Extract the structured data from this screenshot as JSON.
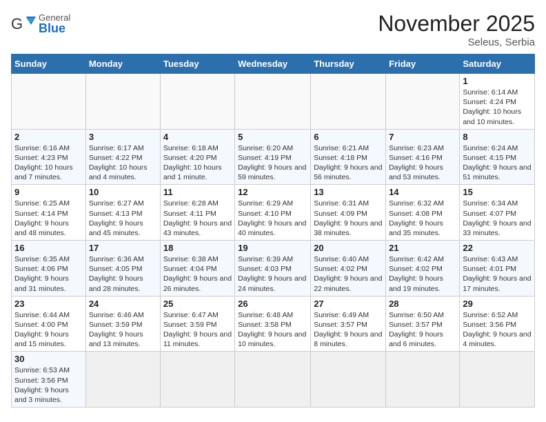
{
  "header": {
    "logo_general": "General",
    "logo_blue": "Blue",
    "month": "November 2025",
    "location": "Seleus, Serbia"
  },
  "days_of_week": [
    "Sunday",
    "Monday",
    "Tuesday",
    "Wednesday",
    "Thursday",
    "Friday",
    "Saturday"
  ],
  "weeks": [
    [
      {
        "day": "",
        "info": ""
      },
      {
        "day": "",
        "info": ""
      },
      {
        "day": "",
        "info": ""
      },
      {
        "day": "",
        "info": ""
      },
      {
        "day": "",
        "info": ""
      },
      {
        "day": "",
        "info": ""
      },
      {
        "day": "1",
        "info": "Sunrise: 6:14 AM\nSunset: 4:24 PM\nDaylight: 10 hours and 10 minutes."
      }
    ],
    [
      {
        "day": "2",
        "info": "Sunrise: 6:16 AM\nSunset: 4:23 PM\nDaylight: 10 hours and 7 minutes."
      },
      {
        "day": "3",
        "info": "Sunrise: 6:17 AM\nSunset: 4:22 PM\nDaylight: 10 hours and 4 minutes."
      },
      {
        "day": "4",
        "info": "Sunrise: 6:18 AM\nSunset: 4:20 PM\nDaylight: 10 hours and 1 minute."
      },
      {
        "day": "5",
        "info": "Sunrise: 6:20 AM\nSunset: 4:19 PM\nDaylight: 9 hours and 59 minutes."
      },
      {
        "day": "6",
        "info": "Sunrise: 6:21 AM\nSunset: 4:18 PM\nDaylight: 9 hours and 56 minutes."
      },
      {
        "day": "7",
        "info": "Sunrise: 6:23 AM\nSunset: 4:16 PM\nDaylight: 9 hours and 53 minutes."
      },
      {
        "day": "8",
        "info": "Sunrise: 6:24 AM\nSunset: 4:15 PM\nDaylight: 9 hours and 51 minutes."
      }
    ],
    [
      {
        "day": "9",
        "info": "Sunrise: 6:25 AM\nSunset: 4:14 PM\nDaylight: 9 hours and 48 minutes."
      },
      {
        "day": "10",
        "info": "Sunrise: 6:27 AM\nSunset: 4:13 PM\nDaylight: 9 hours and 45 minutes."
      },
      {
        "day": "11",
        "info": "Sunrise: 6:28 AM\nSunset: 4:11 PM\nDaylight: 9 hours and 43 minutes."
      },
      {
        "day": "12",
        "info": "Sunrise: 6:29 AM\nSunset: 4:10 PM\nDaylight: 9 hours and 40 minutes."
      },
      {
        "day": "13",
        "info": "Sunrise: 6:31 AM\nSunset: 4:09 PM\nDaylight: 9 hours and 38 minutes."
      },
      {
        "day": "14",
        "info": "Sunrise: 6:32 AM\nSunset: 4:08 PM\nDaylight: 9 hours and 35 minutes."
      },
      {
        "day": "15",
        "info": "Sunrise: 6:34 AM\nSunset: 4:07 PM\nDaylight: 9 hours and 33 minutes."
      }
    ],
    [
      {
        "day": "16",
        "info": "Sunrise: 6:35 AM\nSunset: 4:06 PM\nDaylight: 9 hours and 31 minutes."
      },
      {
        "day": "17",
        "info": "Sunrise: 6:36 AM\nSunset: 4:05 PM\nDaylight: 9 hours and 28 minutes."
      },
      {
        "day": "18",
        "info": "Sunrise: 6:38 AM\nSunset: 4:04 PM\nDaylight: 9 hours and 26 minutes."
      },
      {
        "day": "19",
        "info": "Sunrise: 6:39 AM\nSunset: 4:03 PM\nDaylight: 9 hours and 24 minutes."
      },
      {
        "day": "20",
        "info": "Sunrise: 6:40 AM\nSunset: 4:02 PM\nDaylight: 9 hours and 22 minutes."
      },
      {
        "day": "21",
        "info": "Sunrise: 6:42 AM\nSunset: 4:02 PM\nDaylight: 9 hours and 19 minutes."
      },
      {
        "day": "22",
        "info": "Sunrise: 6:43 AM\nSunset: 4:01 PM\nDaylight: 9 hours and 17 minutes."
      }
    ],
    [
      {
        "day": "23",
        "info": "Sunrise: 6:44 AM\nSunset: 4:00 PM\nDaylight: 9 hours and 15 minutes."
      },
      {
        "day": "24",
        "info": "Sunrise: 6:46 AM\nSunset: 3:59 PM\nDaylight: 9 hours and 13 minutes."
      },
      {
        "day": "25",
        "info": "Sunrise: 6:47 AM\nSunset: 3:59 PM\nDaylight: 9 hours and 11 minutes."
      },
      {
        "day": "26",
        "info": "Sunrise: 6:48 AM\nSunset: 3:58 PM\nDaylight: 9 hours and 10 minutes."
      },
      {
        "day": "27",
        "info": "Sunrise: 6:49 AM\nSunset: 3:57 PM\nDaylight: 9 hours and 8 minutes."
      },
      {
        "day": "28",
        "info": "Sunrise: 6:50 AM\nSunset: 3:57 PM\nDaylight: 9 hours and 6 minutes."
      },
      {
        "day": "29",
        "info": "Sunrise: 6:52 AM\nSunset: 3:56 PM\nDaylight: 9 hours and 4 minutes."
      }
    ],
    [
      {
        "day": "30",
        "info": "Sunrise: 6:53 AM\nSunset: 3:56 PM\nDaylight: 9 hours and 3 minutes."
      },
      {
        "day": "",
        "info": ""
      },
      {
        "day": "",
        "info": ""
      },
      {
        "day": "",
        "info": ""
      },
      {
        "day": "",
        "info": ""
      },
      {
        "day": "",
        "info": ""
      },
      {
        "day": "",
        "info": ""
      }
    ]
  ]
}
